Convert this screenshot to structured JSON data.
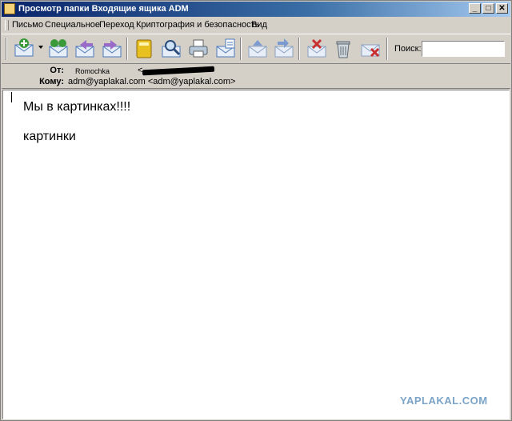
{
  "window": {
    "title": "Просмотр папки Входящие ящика ADM",
    "controls": [
      "_",
      "□",
      "✕"
    ]
  },
  "menu": [
    {
      "label": "Письмо",
      "id": "letter"
    },
    {
      "label": "Специальное",
      "id": "special"
    },
    {
      "label": "Переход",
      "id": "navigate"
    },
    {
      "label": "Криптография и безопасность",
      "id": "crypto"
    },
    {
      "label": "Вид",
      "id": "view"
    }
  ],
  "toolbar": {
    "icons": [
      "new-message-icon",
      "get-mail-icon",
      "reply-icon",
      "forward-icon",
      "address-book-icon",
      "find-icon",
      "print-icon",
      "properties-icon",
      "previous-message-icon",
      "next-message-icon",
      "delete-mark-icon",
      "trash-icon",
      "delete-message-icon"
    ],
    "colors": {
      "green": "#3a9a3a",
      "blue": "#4a78b8",
      "yellow": "#e8c020",
      "red": "#c83030"
    },
    "search_label": "Поиск:",
    "search_value": ""
  },
  "header": {
    "from_label": "От:",
    "from_name": "Romochka",
    "from_email_open": "<",
    "to_label": "Кому:",
    "to_value": "adm@yaplakal.com <adm@yaplakal.com>"
  },
  "message": {
    "line1": "Мы в картинках!!!!",
    "line2": "картинки"
  },
  "watermark": "YAPLAKAL.COM"
}
